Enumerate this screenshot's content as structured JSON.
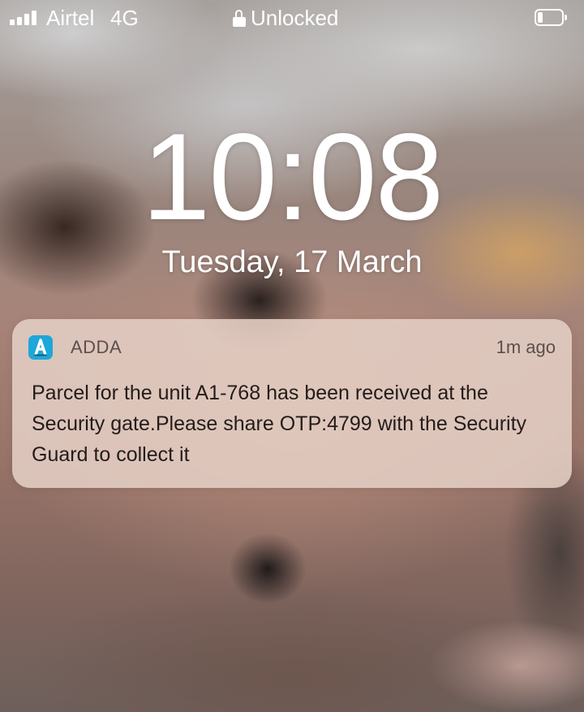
{
  "status_bar": {
    "carrier": "Airtel",
    "network": "4G",
    "lock_status": "Unlocked",
    "signal_bars": 4,
    "battery_level": 0.2,
    "icons": {
      "signal": "signal-icon",
      "lock": "lock-icon",
      "battery": "battery-icon"
    }
  },
  "lock_screen": {
    "time": "10:08",
    "date": "Tuesday, 17 March"
  },
  "notification": {
    "app_name": "ADDA",
    "app_icon": "adda-app-icon",
    "time_ago": "1m ago",
    "message": "Parcel for the unit A1-768 has been received at the Security gate.Please share OTP:4799 with the Security Guard to collect it"
  },
  "colors": {
    "app_icon_bg": "#1ea7d9",
    "notification_bg": "#e4cec4"
  }
}
